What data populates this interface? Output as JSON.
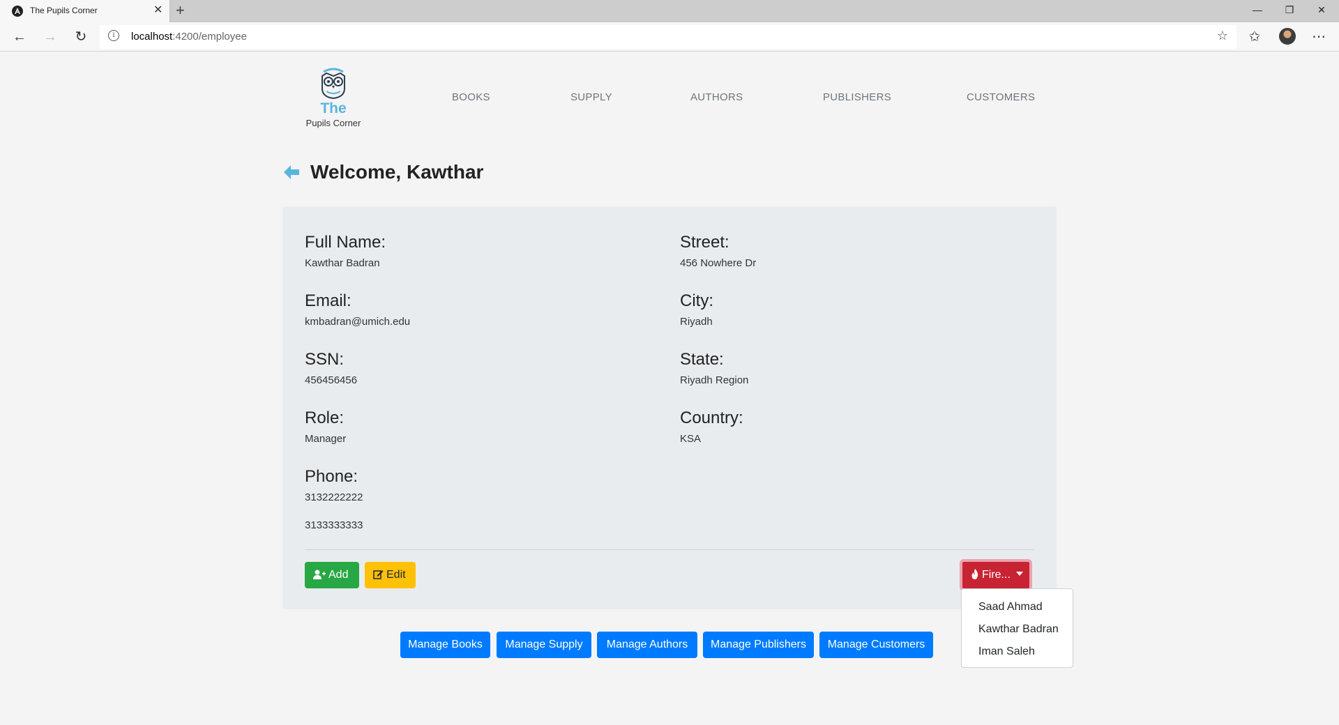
{
  "browser": {
    "tab_title": "The Pupils Corner",
    "url_host": "localhost",
    "url_path": ":4200/employee"
  },
  "logo": {
    "line1": "The",
    "line2": "Pupils Corner"
  },
  "topnav": [
    "BOOKS",
    "SUPPLY",
    "AUTHORS",
    "PUBLISHERS",
    "CUSTOMERS"
  ],
  "welcome": "Welcome, Kawthar",
  "profile": {
    "left": [
      {
        "label": "Full Name:",
        "value": "Kawthar Badran"
      },
      {
        "label": "Email:",
        "value": "kmbadran@umich.edu"
      },
      {
        "label": "SSN:",
        "value": "456456456"
      },
      {
        "label": "Role:",
        "value": "Manager"
      },
      {
        "label": "Phone:",
        "values": [
          "3132222222",
          "3133333333"
        ]
      }
    ],
    "right": [
      {
        "label": "Street:",
        "value": "456 Nowhere Dr"
      },
      {
        "label": "City:",
        "value": "Riyadh"
      },
      {
        "label": "State:",
        "value": "Riyadh Region"
      },
      {
        "label": "Country:",
        "value": "KSA"
      }
    ]
  },
  "actions": {
    "add": "Add",
    "edit": "Edit",
    "fire": "Fire..."
  },
  "fire_menu": [
    "Saad Ahmad",
    "Kawthar Badran",
    "Iman Saleh"
  ],
  "manage": [
    "Manage Books",
    "Manage Supply",
    "Manage Authors",
    "Manage Publishers",
    "Manage Customers"
  ],
  "colors": {
    "add": "#28a745",
    "edit": "#ffc107",
    "fire": "#c82333",
    "manage": "#007bff",
    "brand": "#5bb5dd"
  }
}
